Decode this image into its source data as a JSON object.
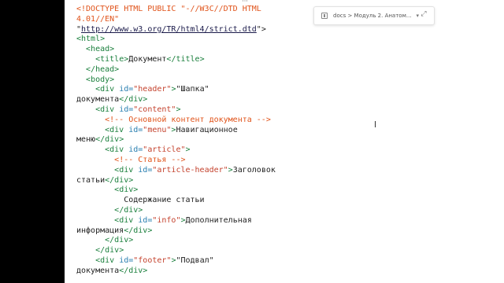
{
  "toolbar": {
    "breadcrumb": "docs > Модуль 2. Анатом...",
    "bookmark_icon": "bookmark-icon",
    "chevron_icon": "chevron-down-icon",
    "expand_icon": "expand-icon",
    "chevron_glyph": "▾",
    "expand_glyph": "⤢",
    "more_glyph": "···"
  },
  "code_lines": [
    [
      {
        "c": "doctype",
        "t": "<!DOCTYPE HTML PUBLIC \"-//W3C//DTD HTML"
      }
    ],
    [
      {
        "c": "doctype",
        "t": "4.01//EN\""
      }
    ],
    [
      {
        "c": "txt",
        "t": "\""
      },
      {
        "c": "link",
        "t": "http://www.w3.org/TR/html4/strict.dtd"
      },
      {
        "c": "txt",
        "t": "\">"
      }
    ],
    [
      {
        "c": "tag",
        "t": "<html>"
      }
    ],
    [
      {
        "c": "txt",
        "t": "  "
      },
      {
        "c": "tag",
        "t": "<head>"
      }
    ],
    [
      {
        "c": "txt",
        "t": "    "
      },
      {
        "c": "tag",
        "t": "<title>"
      },
      {
        "c": "txt",
        "t": "Документ"
      },
      {
        "c": "tag",
        "t": "</title>"
      }
    ],
    [
      {
        "c": "txt",
        "t": "  "
      },
      {
        "c": "tag",
        "t": "</head>"
      }
    ],
    [
      {
        "c": "txt",
        "t": "  "
      },
      {
        "c": "tag",
        "t": "<body>"
      }
    ],
    [
      {
        "c": "txt",
        "t": "    "
      },
      {
        "c": "tag",
        "t": "<div "
      },
      {
        "c": "attr",
        "t": "id="
      },
      {
        "c": "str",
        "t": "\"header\""
      },
      {
        "c": "tag",
        "t": ">"
      },
      {
        "c": "txt",
        "t": "\"Шапка\""
      }
    ],
    [
      {
        "c": "txt",
        "t": "документа"
      },
      {
        "c": "tag",
        "t": "</div>"
      }
    ],
    [
      {
        "c": "txt",
        "t": "    "
      },
      {
        "c": "tag",
        "t": "<div "
      },
      {
        "c": "attr",
        "t": "id="
      },
      {
        "c": "str",
        "t": "\"content\""
      },
      {
        "c": "tag",
        "t": ">"
      }
    ],
    [
      {
        "c": "txt",
        "t": "      "
      },
      {
        "c": "cmt",
        "t": "<!-- Основной контент документа -->"
      }
    ],
    [
      {
        "c": "txt",
        "t": "      "
      },
      {
        "c": "tag",
        "t": "<div "
      },
      {
        "c": "attr",
        "t": "id="
      },
      {
        "c": "str",
        "t": "\"menu\""
      },
      {
        "c": "tag",
        "t": ">"
      },
      {
        "c": "txt",
        "t": "Навигационное"
      }
    ],
    [
      {
        "c": "txt",
        "t": "меню"
      },
      {
        "c": "tag",
        "t": "</div>"
      }
    ],
    [
      {
        "c": "txt",
        "t": "      "
      },
      {
        "c": "tag",
        "t": "<div "
      },
      {
        "c": "attr",
        "t": "id="
      },
      {
        "c": "str",
        "t": "\"article\""
      },
      {
        "c": "tag",
        "t": ">"
      }
    ],
    [
      {
        "c": "txt",
        "t": "        "
      },
      {
        "c": "cmt",
        "t": "<!-- Статья -->"
      }
    ],
    [
      {
        "c": "txt",
        "t": "        "
      },
      {
        "c": "tag",
        "t": "<div "
      },
      {
        "c": "attr",
        "t": "id="
      },
      {
        "c": "str",
        "t": "\"article-header\""
      },
      {
        "c": "tag",
        "t": ">"
      },
      {
        "c": "txt",
        "t": "Заголовок"
      }
    ],
    [
      {
        "c": "txt",
        "t": "статьи"
      },
      {
        "c": "tag",
        "t": "</div>"
      }
    ],
    [
      {
        "c": "txt",
        "t": "        "
      },
      {
        "c": "tag",
        "t": "<div>"
      }
    ],
    [
      {
        "c": "txt",
        "t": "          Содержание статьи"
      }
    ],
    [
      {
        "c": "txt",
        "t": "        "
      },
      {
        "c": "tag",
        "t": "</div>"
      }
    ],
    [
      {
        "c": "txt",
        "t": "        "
      },
      {
        "c": "tag",
        "t": "<div "
      },
      {
        "c": "attr",
        "t": "id="
      },
      {
        "c": "str",
        "t": "\"info\""
      },
      {
        "c": "tag",
        "t": ">"
      },
      {
        "c": "txt",
        "t": "Дополнительная"
      }
    ],
    [
      {
        "c": "txt",
        "t": "информация"
      },
      {
        "c": "tag",
        "t": "</div>"
      }
    ],
    [
      {
        "c": "txt",
        "t": "      "
      },
      {
        "c": "tag",
        "t": "</div>"
      }
    ],
    [
      {
        "c": "txt",
        "t": "    "
      },
      {
        "c": "tag",
        "t": "</div>"
      }
    ],
    [
      {
        "c": "txt",
        "t": "    "
      },
      {
        "c": "tag",
        "t": "<div "
      },
      {
        "c": "attr",
        "t": "id="
      },
      {
        "c": "str",
        "t": "\"footer\""
      },
      {
        "c": "tag",
        "t": ">"
      },
      {
        "c": "txt",
        "t": "\"Подвал\""
      }
    ],
    [
      {
        "c": "txt",
        "t": "документа"
      },
      {
        "c": "tag",
        "t": "</div>"
      }
    ]
  ],
  "colors": {
    "background": "#000000",
    "page": "#ffffff",
    "doctype": "#e0531a",
    "tag": "#1a7f3c",
    "attr": "#2a7fb0",
    "string": "#c4422d",
    "comment": "#e0531a",
    "text": "#222222"
  }
}
